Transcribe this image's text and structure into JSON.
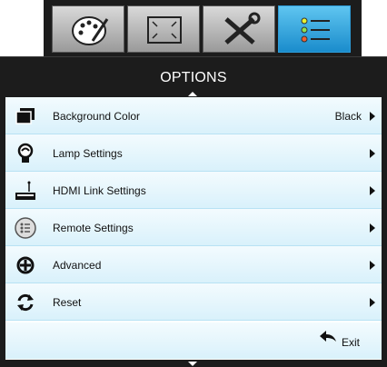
{
  "header": {
    "title": "OPTIONS",
    "tabs": [
      {
        "icon": "palette-icon",
        "active": false
      },
      {
        "icon": "screen-resize-icon",
        "active": false
      },
      {
        "icon": "tools-icon",
        "active": false
      },
      {
        "icon": "options-list-icon",
        "active": true
      }
    ]
  },
  "menu": {
    "items": [
      {
        "label": "Background Color",
        "value": "Black",
        "icon": "background-color-icon"
      },
      {
        "label": "Lamp Settings",
        "value": "",
        "icon": "lamp-icon"
      },
      {
        "label": "HDMI Link Settings",
        "value": "",
        "icon": "hdmi-link-icon"
      },
      {
        "label": "Remote Settings",
        "value": "",
        "icon": "remote-icon"
      },
      {
        "label": "Advanced",
        "value": "",
        "icon": "advanced-icon"
      },
      {
        "label": "Reset",
        "value": "",
        "icon": "reset-icon"
      }
    ]
  },
  "footer": {
    "exit_label": "Exit",
    "exit_icon": "back-arrow-icon"
  },
  "colors": {
    "accent": "#1a8ccc",
    "row_bg": "#e3f5fc",
    "bar": "#1c1c1c"
  }
}
